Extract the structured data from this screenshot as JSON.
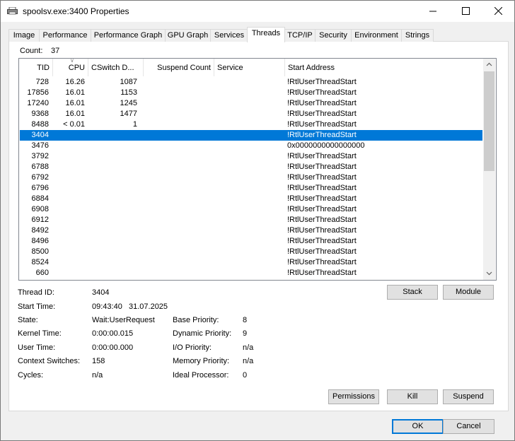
{
  "window": {
    "title": "spoolsv.exe:3400 Properties"
  },
  "title_controls": {
    "minimize": "—",
    "maximize": "☐",
    "close": "✕"
  },
  "tabs": [
    {
      "label": "Image"
    },
    {
      "label": "Performance"
    },
    {
      "label": "Performance Graph"
    },
    {
      "label": "GPU Graph"
    },
    {
      "label": "Services"
    },
    {
      "label": "Threads"
    },
    {
      "label": "TCP/IP"
    },
    {
      "label": "Security"
    },
    {
      "label": "Environment"
    },
    {
      "label": "Strings"
    }
  ],
  "active_tab": "Threads",
  "threads": {
    "count_label": "Count:",
    "count_value": "37",
    "columns": [
      {
        "label": "TID"
      },
      {
        "label": "CPU"
      },
      {
        "label": "CSwitch D..."
      },
      {
        "label": "Suspend Count"
      },
      {
        "label": "Service"
      },
      {
        "label": "Start Address"
      }
    ],
    "rows": [
      {
        "tid": "728",
        "cpu": "16.26",
        "cswitch": "1087",
        "start": "!RtlUserThreadStart"
      },
      {
        "tid": "17856",
        "cpu": "16.01",
        "cswitch": "1153",
        "start": "!RtlUserThreadStart"
      },
      {
        "tid": "17240",
        "cpu": "16.01",
        "cswitch": "1245",
        "start": "!RtlUserThreadStart"
      },
      {
        "tid": "9368",
        "cpu": "16.01",
        "cswitch": "1477",
        "start": "!RtlUserThreadStart"
      },
      {
        "tid": "8488",
        "cpu": "< 0.01",
        "cswitch": "1",
        "start": "!RtlUserThreadStart"
      },
      {
        "tid": "3404",
        "cpu": "",
        "cswitch": "",
        "start": "!RtlUserThreadStart",
        "selected": true
      },
      {
        "tid": "3476",
        "cpu": "",
        "cswitch": "",
        "start": "0x0000000000000000"
      },
      {
        "tid": "3792",
        "cpu": "",
        "cswitch": "",
        "start": "!RtlUserThreadStart"
      },
      {
        "tid": "6788",
        "cpu": "",
        "cswitch": "",
        "start": "!RtlUserThreadStart"
      },
      {
        "tid": "6792",
        "cpu": "",
        "cswitch": "",
        "start": "!RtlUserThreadStart"
      },
      {
        "tid": "6796",
        "cpu": "",
        "cswitch": "",
        "start": "!RtlUserThreadStart"
      },
      {
        "tid": "6884",
        "cpu": "",
        "cswitch": "",
        "start": "!RtlUserThreadStart"
      },
      {
        "tid": "6908",
        "cpu": "",
        "cswitch": "",
        "start": "!RtlUserThreadStart"
      },
      {
        "tid": "6912",
        "cpu": "",
        "cswitch": "",
        "start": "!RtlUserThreadStart"
      },
      {
        "tid": "8492",
        "cpu": "",
        "cswitch": "",
        "start": "!RtlUserThreadStart"
      },
      {
        "tid": "8496",
        "cpu": "",
        "cswitch": "",
        "start": "!RtlUserThreadStart"
      },
      {
        "tid": "8500",
        "cpu": "",
        "cswitch": "",
        "start": "!RtlUserThreadStart"
      },
      {
        "tid": "8524",
        "cpu": "",
        "cswitch": "",
        "start": "!RtlUserThreadStart"
      },
      {
        "tid": "660",
        "cpu": "",
        "cswitch": "",
        "start": "!RtlUserThreadStart"
      }
    ]
  },
  "details": {
    "thread_id_label": "Thread ID:",
    "thread_id": "3404",
    "start_time_label": "Start Time:",
    "start_time": "09:43:40   31.07.2025",
    "state_label": "State:",
    "state": "Wait:UserRequest",
    "kernel_time_label": "Kernel Time:",
    "kernel_time": "0:00:00.015",
    "user_time_label": "User Time:",
    "user_time": "0:00:00.000",
    "context_switches_label": "Context Switches:",
    "context_switches": "158",
    "cycles_label": "Cycles:",
    "cycles": "n/a",
    "base_priority_label": "Base Priority:",
    "base_priority": "8",
    "dynamic_priority_label": "Dynamic Priority:",
    "dynamic_priority": "9",
    "io_priority_label": "I/O Priority:",
    "io_priority": "n/a",
    "memory_priority_label": "Memory Priority:",
    "memory_priority": "n/a",
    "ideal_processor_label": "Ideal Processor:",
    "ideal_processor": "0"
  },
  "buttons": {
    "stack": "Stack",
    "module": "Module",
    "permissions": "Permissions",
    "kill": "Kill",
    "suspend": "Suspend",
    "ok": "OK",
    "cancel": "Cancel"
  },
  "colors": {
    "selection": "#0078d7",
    "default_button_border": "#0078d7"
  }
}
